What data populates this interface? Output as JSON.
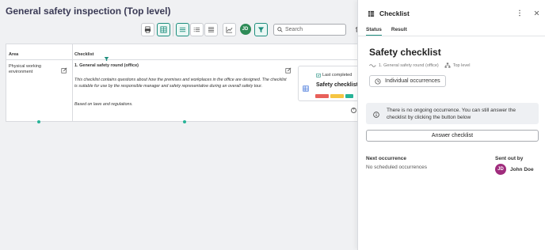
{
  "page": {
    "title": "General safety inspection (Top level)"
  },
  "toolbar": {
    "search_placeholder": "Search",
    "avatar_initials": "JD"
  },
  "table": {
    "headers": {
      "area": "Area",
      "checklist": "Checklist"
    },
    "area_label": "Physical working environment",
    "checklist_title": "1. General safety round (office)",
    "description": "This checklist contains questions about how the premises and workplaces in the office are designed. The checklist is suitable for use by the responsible manager and safety representative during an overall safety tour.",
    "basis": "Based on laws and regulations.",
    "card": {
      "last_completed": "Last completed",
      "title": "Safety checklist",
      "status_colors": [
        "#e8605a",
        "#f5c542",
        "#27b397"
      ]
    }
  },
  "panel": {
    "header_title": "Checklist",
    "tabs": [
      "Status",
      "Result"
    ],
    "active_tab": "Status",
    "title": "Safety checklist",
    "breadcrumb": [
      "1. General safety round (office)",
      "Top level"
    ],
    "individual_occurrences": "Individual occurrences",
    "info_text": "There is no ongoing occurrence. You can still answer the checklist by clicking the button below",
    "answer_button": "Answer checklist",
    "next_occurrence_label": "Next occurrence",
    "next_occurrence_value": "No scheduled occurrences",
    "sent_out_by_label": "Sent out by",
    "sender_initials": "JD",
    "sender_name": "John Doe"
  },
  "colors": {
    "accent": "#1e8e7e",
    "sender_avatar": "#a02c7d",
    "toolbar_avatar": "#2e8b57"
  }
}
